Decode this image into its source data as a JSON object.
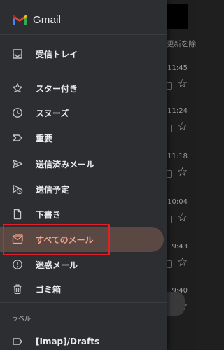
{
  "app": {
    "title": "Gmail"
  },
  "background": {
    "sync_text": "更新を除",
    "rows": [
      {
        "time": "11:45",
        "snippet": ""
      },
      {
        "time": "11:24",
        "snippet": "."
      },
      {
        "time": "11:18",
        "snippet": "."
      },
      {
        "time": "10:04",
        "snippet": ""
      },
      {
        "time": "9:43",
        "snippet": ""
      },
      {
        "time": "9:40",
        "snippet": ""
      }
    ]
  },
  "drawer": {
    "items": [
      {
        "label": "受信トレイ",
        "icon": "inbox-icon"
      },
      {
        "label": "スター付き",
        "icon": "star-icon"
      },
      {
        "label": "スヌーズ",
        "icon": "clock-icon"
      },
      {
        "label": "重要",
        "icon": "important-icon"
      },
      {
        "label": "送信済みメール",
        "icon": "send-icon"
      },
      {
        "label": "送信予定",
        "icon": "scheduled-send-icon"
      },
      {
        "label": "下書き",
        "icon": "draft-icon"
      },
      {
        "label": "すべてのメール",
        "icon": "all-mail-icon",
        "selected": true
      },
      {
        "label": "迷惑メール",
        "icon": "spam-icon"
      },
      {
        "label": "ゴミ箱",
        "icon": "trash-icon"
      }
    ],
    "section_label": "ラベル",
    "labels": [
      {
        "label": "[Imap]/Drafts",
        "icon": "label-icon"
      }
    ]
  },
  "colors": {
    "drawer_bg": "#2d2e31",
    "selected_bg": "#5b4843",
    "selected_text": "#f0a48e",
    "highlight_border": "#e0202a"
  }
}
